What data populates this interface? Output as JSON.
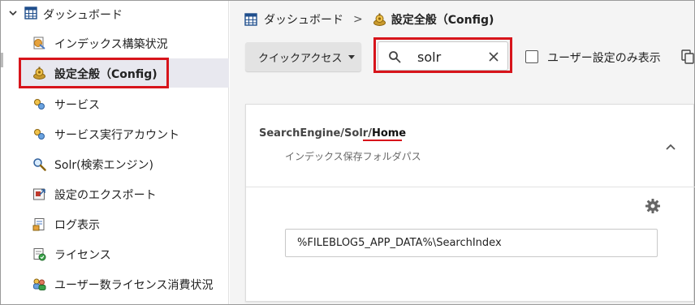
{
  "sidebar": {
    "root": {
      "label": "ダッシュボード",
      "icon": "dashboard-grid-icon"
    },
    "items": [
      {
        "label": "インデックス構築状況",
        "icon": "index-build-icon",
        "active": false
      },
      {
        "label": "設定全般（Config)",
        "icon": "config-gear-icon",
        "active": true
      },
      {
        "label": "サービス",
        "icon": "service-icon",
        "active": false
      },
      {
        "label": "サービス実行アカウント",
        "icon": "service-account-icon",
        "active": false
      },
      {
        "label": "Solr(検索エンジン)",
        "icon": "search-engine-icon",
        "active": false
      },
      {
        "label": "設定のエクスポート",
        "icon": "export-icon",
        "active": false
      },
      {
        "label": "ログ表示",
        "icon": "log-icon",
        "active": false
      },
      {
        "label": "ライセンス",
        "icon": "license-icon",
        "active": false
      },
      {
        "label": "ユーザー数ライセンス消費状況",
        "icon": "user-license-icon",
        "active": false
      }
    ]
  },
  "breadcrumb": {
    "root": "ダッシュボード",
    "separator": ">",
    "current": "設定全般（Config)"
  },
  "toolbar": {
    "quick_access_label": "クイックアクセス",
    "search_value": "solr",
    "user_settings_only_label": "ユーザー設定のみ表示",
    "user_settings_only_checked": false
  },
  "setting": {
    "key_prefix": "SearchEngine/Solr/",
    "key_name": "Home",
    "description": "インデックス保存フォルダパス",
    "value": "%FILEBLOG5_APP_DATA%\\SearchIndex"
  },
  "colors": {
    "highlight": "#d7141b",
    "active_item_bg": "#e8e8ef",
    "main_bg": "#f4f4f4"
  }
}
